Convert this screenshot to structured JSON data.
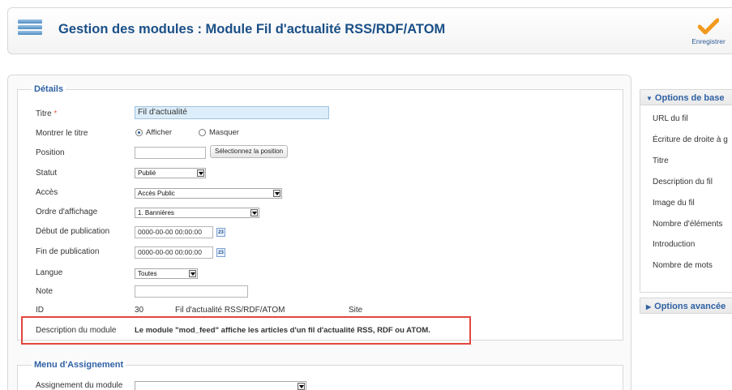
{
  "header": {
    "title": "Gestion des modules : Module Fil d'actualité RSS/RDF/ATOM",
    "save_label": "Enregistrer"
  },
  "details": {
    "legend": "Détails",
    "title_label": "Titre",
    "title_required": "*",
    "title_value": "Fil d'actualité",
    "show_title_label": "Montrer le titre",
    "show_option": "Afficher",
    "hide_option": "Masquer",
    "show_title_selected": "Afficher",
    "position_label": "Position",
    "position_value": "",
    "position_button": "Sélectionnez la position",
    "status_label": "Statut",
    "status_value": "Publié",
    "access_label": "Accès",
    "access_value": "Accès Public",
    "order_label": "Ordre d'affichage",
    "order_value": "1. Bannières",
    "publish_up_label": "Début de publication",
    "publish_up_value": "0000-00-00 00:00:00",
    "publish_down_label": "Fin de publication",
    "publish_down_value": "0000-00-00 00:00:00",
    "calendar_glyph": "23",
    "language_label": "Langue",
    "language_value": "Toutes",
    "note_label": "Note",
    "note_value": "",
    "id_label": "ID",
    "id_value": "30",
    "id_module": "Fil d'actualité RSS/RDF/ATOM",
    "id_client": "Site",
    "description_label": "Description du module",
    "description_text": "Le module \"mod_feed\" affiche les articles d'un fil d'actualité RSS, RDF ou ATOM."
  },
  "menu_assignment": {
    "legend": "Menu d'Assignement",
    "label": "Assignement du module"
  },
  "sidebar": {
    "basic_title": "Options de base",
    "items": [
      "URL du fil",
      "Écriture de droite à g",
      "Titre",
      "Description du fil",
      "Image du fil",
      "Nombre d'éléments",
      "Introduction",
      "Nombre de mots"
    ],
    "advanced_title": "Options avancée"
  },
  "colors": {
    "title_blue": "#1a4f87",
    "legend_blue": "#2f61a3",
    "highlight_red": "#e2473f",
    "title_input_bg": "#ddeefa",
    "check_orange": "#f29a1f"
  }
}
